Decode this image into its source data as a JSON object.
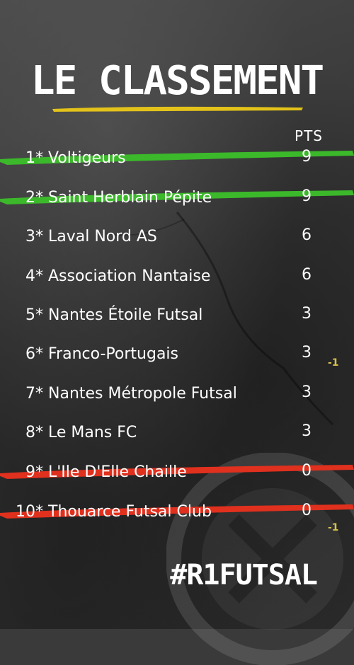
{
  "header": {
    "title": "LE CLASSEMENT",
    "pts_label": "PTS"
  },
  "rows": [
    {
      "rank": "1*",
      "team": "Voltigeurs",
      "pts": "9",
      "highlight": "green"
    },
    {
      "rank": "2*",
      "team": "Saint Herblain Pépite",
      "pts": "9",
      "highlight": "green"
    },
    {
      "rank": "3*",
      "team": "Laval Nord AS",
      "pts": "6",
      "highlight": "none"
    },
    {
      "rank": "4*",
      "team": "Association Nantaise",
      "pts": "6",
      "highlight": "none"
    },
    {
      "rank": "5*",
      "team": "Nantes Étoile Futsal",
      "pts": "3",
      "highlight": "none"
    },
    {
      "rank": "6*",
      "team": "Franco-Portugais",
      "pts": "3",
      "highlight": "none",
      "note": "-1"
    },
    {
      "rank": "7*",
      "team": "Nantes Métropole Futsal",
      "pts": "3",
      "highlight": "none"
    },
    {
      "rank": "8*",
      "team": "Le Mans FC",
      "pts": "3",
      "highlight": "none"
    },
    {
      "rank": "9*",
      "team": "L'Ile D'Elle Chaille",
      "pts": "0",
      "highlight": "red"
    },
    {
      "rank": "10*",
      "team": "Thouarce Futsal Club",
      "pts": "0",
      "highlight": "red",
      "note": "-1"
    }
  ],
  "footer": {
    "hashtag": "#R1FUTSAL"
  },
  "colors": {
    "green": "#3cb82b",
    "red": "#e0301e",
    "yellow": "#e3c21a",
    "note": "#d8c24a"
  }
}
